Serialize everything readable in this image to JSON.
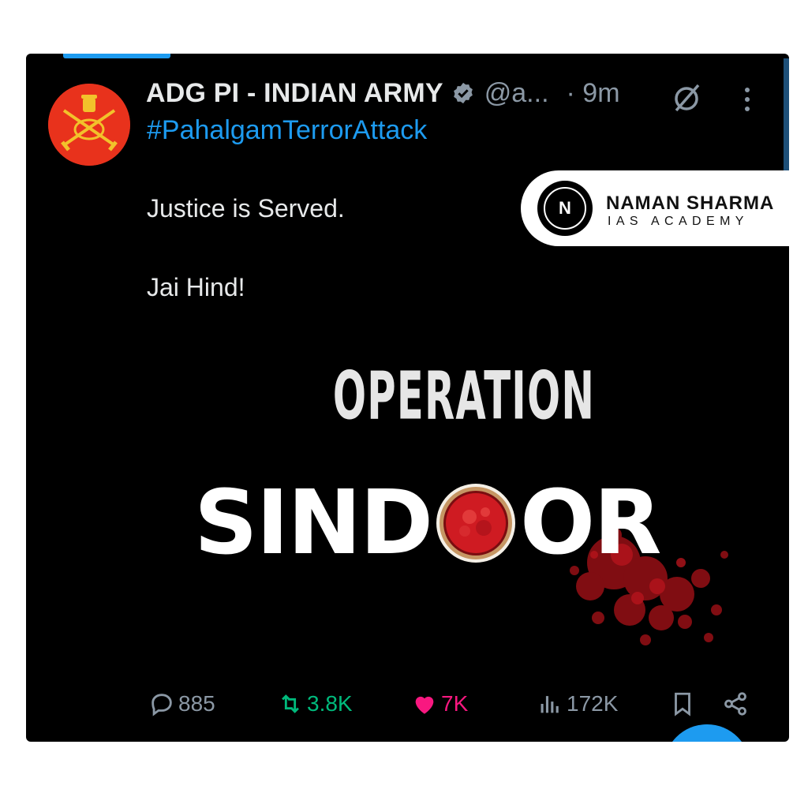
{
  "post": {
    "author_name": "ADG PI - INDIAN ARMY",
    "handle": "@a...",
    "time": "· 9m",
    "hashtag": "#PahalgamTerrorAttack",
    "body_lines": [
      "Justice is Served.",
      "Jai Hind!"
    ]
  },
  "poster": {
    "line1": "OPERATION",
    "sindoor_left": "SIND",
    "sindoor_right": "OR"
  },
  "actions": {
    "replies": "885",
    "reposts": "3.8K",
    "likes": "7K",
    "views": "172K"
  },
  "watermark": {
    "logo_letter": "N",
    "title": "NAMAN SHARMA",
    "subtitle": "IAS ACADEMY"
  },
  "colors": {
    "accent": "#1d9bf0",
    "repost": "#00ba7c",
    "like": "#f91880",
    "muted": "#8b98a5",
    "avatar": "#e8321c"
  },
  "icons": [
    "verified-badge-icon",
    "grok-icon",
    "more-icon",
    "reply-icon",
    "repost-icon",
    "like-icon",
    "views-icon",
    "bookmark-icon",
    "share-icon"
  ]
}
